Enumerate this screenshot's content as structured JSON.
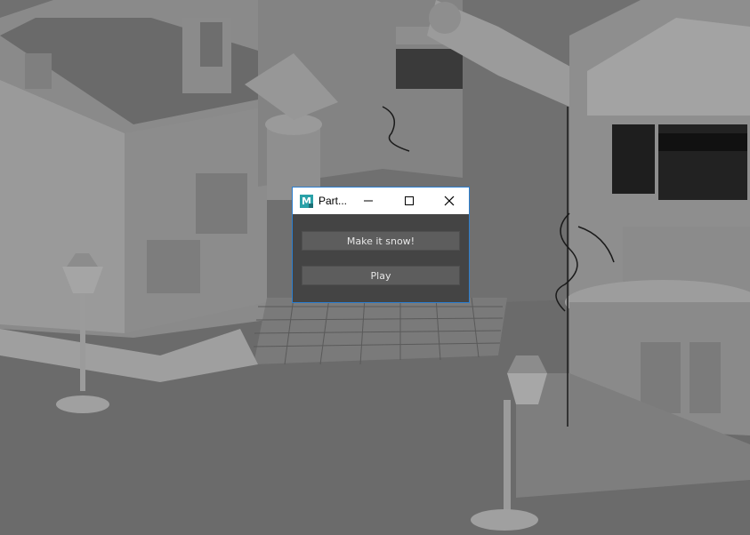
{
  "dialog": {
    "title": "Part...",
    "app_icon_letter": "M",
    "buttons": {
      "make_snow": "Make it snow!",
      "play": "Play"
    },
    "window_controls": [
      "minimize-icon",
      "maximize-icon",
      "close-icon"
    ]
  },
  "colors": {
    "viewport_bg": "#6f6f6f",
    "dialog_bg": "#444444",
    "button_bg": "#5d5d5d",
    "accent_border": "#2c7fd0",
    "icon_teal": "#2aa1a8"
  }
}
